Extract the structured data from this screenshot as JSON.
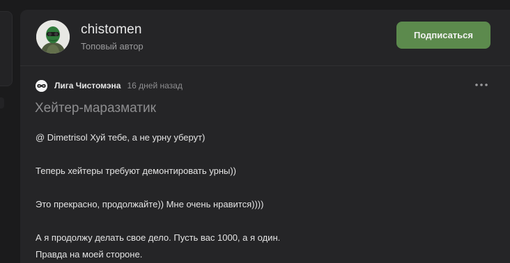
{
  "author": {
    "name": "chistomen",
    "status": "Топовый автор",
    "subscribe_label": "Подписаться"
  },
  "post": {
    "community": "Лига Чистомэна",
    "time": "16 дней назад",
    "title": "Хейтер-маразматик",
    "paragraphs": {
      "p1": "@ Dimetrisol Хуй тебе, а не урну уберут)",
      "p2": "Теперь хейтеры требуют демонтировать урны))",
      "p3": "Это прекрасно, продолжайте)) Мне очень нравится))))",
      "p4_line1": "А я продолжу делать свое дело. Пусть вас 1000, а я один.",
      "p4_line2": "Правда на моей стороне."
    }
  },
  "colors": {
    "background": "#1b1b1c",
    "card": "#252527",
    "accent_button": "#5c8a4d"
  },
  "icons": {
    "avatar": "masked-person-avatar",
    "community": "infinity-logo-icon",
    "more": "more-dots-icon"
  }
}
